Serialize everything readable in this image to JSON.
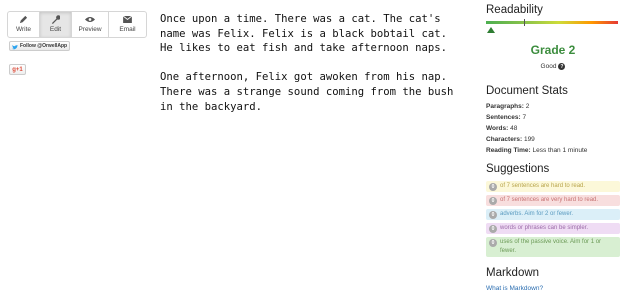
{
  "toolbar": {
    "write_label": "Write",
    "edit_label": "Edit",
    "preview_label": "Preview",
    "email_label": "Email"
  },
  "social": {
    "follow_label": "Follow @OrwellApp",
    "gplus_label": "g+1"
  },
  "editor": {
    "paragraphs": [
      "Once upon a time. There was a cat. The cat's name was Felix. Felix is a black bobtail cat. He likes to eat fish and take afternoon naps.",
      "One afternoon, Felix got awoken from his nap. There was a strange sound coming from the bush in the backyard."
    ]
  },
  "readability": {
    "heading": "Readability",
    "grade": "Grade 2",
    "rating": "Good",
    "meter_level_fraction": 0.05,
    "help_icon": "question-circle-icon"
  },
  "stats": {
    "heading": "Document Stats",
    "items": [
      {
        "label": "Paragraphs:",
        "value": "2"
      },
      {
        "label": "Sentences:",
        "value": "7"
      },
      {
        "label": "Words:",
        "value": "48"
      },
      {
        "label": "Characters:",
        "value": "199"
      },
      {
        "label": "Reading Time:",
        "value": "Less than 1 minute"
      }
    ]
  },
  "suggestions": {
    "heading": "Suggestions",
    "items": [
      {
        "count": "0",
        "text": "of 7 sentences are hard to read."
      },
      {
        "count": "0",
        "text": "of 7 sentences are very hard to read."
      },
      {
        "count": "0",
        "text": "adverbs. Aim for 2 or fewer."
      },
      {
        "count": "0",
        "text": "words or phrases can be simpler."
      },
      {
        "count": "0",
        "text": "uses of the passive voice. Aim for 1 or fewer."
      }
    ]
  },
  "markdown": {
    "heading": "Markdown",
    "link": "What is Markdown?"
  },
  "colors": {
    "grade_green": "#3c8d3e",
    "link_blue": "#2a6db0"
  }
}
